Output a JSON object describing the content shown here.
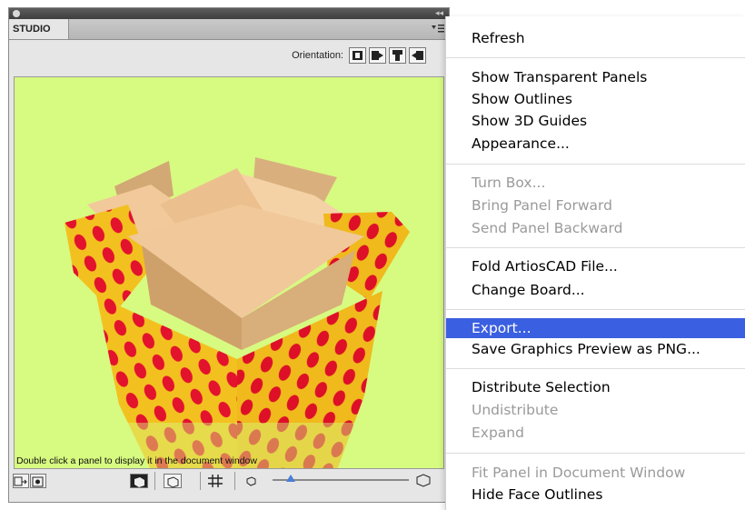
{
  "panel": {
    "tab_label": "STUDIO",
    "orientation_label": "Orientation:",
    "orientation_icons": [
      "orientation-front-icon",
      "orientation-side-icon",
      "orientation-top-icon",
      "orientation-back-icon"
    ],
    "hint_text": "Double click a panel to display it in the document window",
    "viewport_color": "#d7fa81"
  },
  "menu": {
    "items": [
      {
        "label": "Refresh",
        "enabled": true
      },
      {
        "label": "Show Transparent Panels",
        "enabled": true
      },
      {
        "label": "Show Outlines",
        "enabled": true
      },
      {
        "label": "Show 3D Guides",
        "enabled": true
      },
      {
        "label": "Appearance...",
        "enabled": true
      },
      {
        "label": "Turn Box...",
        "enabled": false
      },
      {
        "label": "Bring Panel Forward",
        "enabled": false
      },
      {
        "label": "Send Panel Backward",
        "enabled": false
      },
      {
        "label": "Fold ArtiosCAD File...",
        "enabled": true
      },
      {
        "label": "Change Board...",
        "enabled": true
      },
      {
        "label": "Export...",
        "enabled": true,
        "highlighted": true
      },
      {
        "label": "Save Graphics Preview as PNG...",
        "enabled": true
      },
      {
        "label": "Distribute Selection",
        "enabled": true
      },
      {
        "label": "Undistribute",
        "enabled": false
      },
      {
        "label": "Expand",
        "enabled": false
      },
      {
        "label": "Fit Panel in Document Window",
        "enabled": false
      },
      {
        "label": "Hide Face Outlines",
        "enabled": true
      }
    ],
    "highlight_color": "#3a5fe0"
  }
}
